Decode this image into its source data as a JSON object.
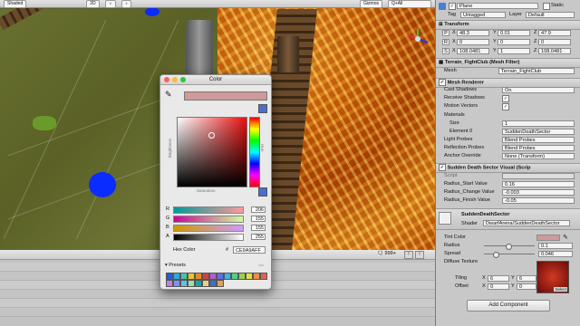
{
  "scene_toolbar": {
    "shading_mode": "Shaded",
    "mode_2d": "2D",
    "gizmos": "Gizmos",
    "search_placeholder": "Q+All"
  },
  "bottom_panel": {
    "search_count": "999+"
  },
  "color_picker": {
    "title": "Color",
    "brightness_label": "Brightness",
    "saturation_label": "Saturation",
    "hue_label": "Hue",
    "channels": [
      {
        "label": "R",
        "value": "206"
      },
      {
        "label": "G",
        "value": "155"
      },
      {
        "label": "B",
        "value": "155"
      },
      {
        "label": "A",
        "value": "255"
      }
    ],
    "hex_label": "Hex Color",
    "hex_prefix": "#",
    "hex_value": "CE9A9AFF",
    "presets_label": "Presets",
    "current_color": "#ce9a9a",
    "preset_colors": [
      "#1e5fd6",
      "#2fa8d8",
      "#47c4a8",
      "#f0c030",
      "#e88a20",
      "#d04040",
      "#b060d0",
      "#6070e0",
      "#40b0f0",
      "#50d080",
      "#9bd050",
      "#e0e040",
      "#f09040",
      "#e06060",
      "#c080e0",
      "#8090f0",
      "#60c0e0",
      "#a0e0a0",
      "#20a0a0",
      "#f0d080",
      "#4070c0",
      "#e0a060"
    ]
  },
  "inspector": {
    "object_name": "Plane",
    "static_label": "Static",
    "tag_label": "Tag",
    "tag_value": "Untagged",
    "layer_label": "Layer",
    "layer_value": "Default",
    "transform": {
      "title": "Transform",
      "rows": [
        {
          "key": "P",
          "x": "48.3",
          "y": "0.01",
          "z": "47.9"
        },
        {
          "key": "R",
          "x": "0",
          "y": "0",
          "z": "0"
        },
        {
          "key": "S",
          "x": "108.0481",
          "y": "1",
          "z": "108.0481"
        }
      ]
    },
    "mesh_filter": {
      "title": "Terrain_FightClub (Mesh Filter)",
      "mesh_label": "Mesh",
      "mesh_value": "Terrain_FightClub"
    },
    "mesh_renderer": {
      "title": "Mesh Renderer",
      "cast_shadows_label": "Cast Shadows",
      "cast_shadows_value": "On",
      "receive_shadows_label": "Receive Shadows",
      "motion_vectors_label": "Motion Vectors",
      "materials_label": "Materials",
      "size_label": "Size",
      "size_value": "1",
      "element_label": "Element 0",
      "element_value": "SuddenDeathSector",
      "light_probes_label": "Light Probes",
      "light_probes_value": "Blend Probes",
      "reflection_probes_label": "Reflection Probes",
      "reflection_probes_value": "Blend Probes",
      "anchor_label": "Anchor Override",
      "anchor_value": "None (Transform)"
    },
    "script_comp": {
      "title": "Sudden Death Sector Visual (Scrip",
      "script_label": "Script",
      "rows": [
        {
          "label": "Radius_Start Value",
          "value": "0.16"
        },
        {
          "label": "Radius_Change Value",
          "value": "-0.003"
        },
        {
          "label": "Radius_Finish Value",
          "value": "-0.05"
        }
      ]
    },
    "material": {
      "name": "SuddenDeathSector",
      "shader_label": "Shader",
      "shader_value": "DwarfArena/SuddenDeathSector",
      "tint_label": "Tint Color",
      "tint_color": "#ce9a9a",
      "radius_label": "Radius",
      "radius_value": "0.1",
      "spread_label": "Spread",
      "spread_value": "0.046",
      "diffuse_label": "Diffuse Texture",
      "tiling_label": "Tiling",
      "tiling_x": "6",
      "tiling_y": "6",
      "offset_label": "Offset",
      "offset_x": "0",
      "offset_y": "0",
      "select_label": "Select"
    },
    "add_component_label": "Add Component"
  }
}
